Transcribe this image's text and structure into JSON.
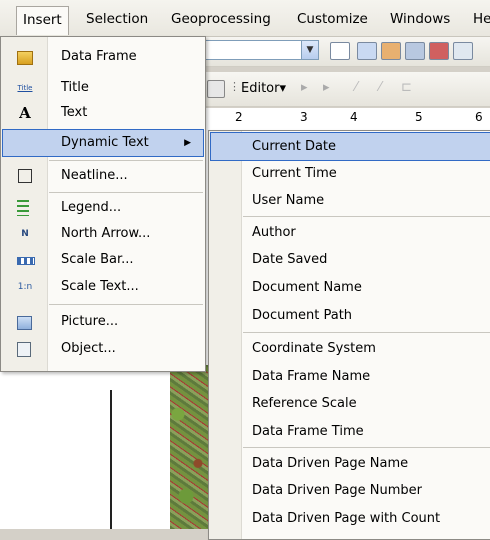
{
  "menubar": {
    "items": [
      "Insert",
      "Selection",
      "Geoprocessing",
      "Customize",
      "Windows",
      "He"
    ]
  },
  "toolbar": {
    "editor_label": "Editor▾"
  },
  "ruler": {
    "ticks": [
      "2",
      "3",
      "4",
      "5",
      "6"
    ]
  },
  "insert_menu": {
    "items": [
      {
        "label": "Data Frame",
        "icon": "data-frame-icon"
      },
      {
        "label": "Title",
        "icon": "title-icon"
      },
      {
        "label": "Text",
        "icon": "text-icon"
      },
      {
        "label": "Dynamic Text",
        "icon": "",
        "submenu": true,
        "highlighted": true
      },
      {
        "label": "Neatline...",
        "icon": "neatline-icon"
      },
      {
        "label": "Legend...",
        "icon": "legend-icon"
      },
      {
        "label": "North Arrow...",
        "icon": "north-arrow-icon"
      },
      {
        "label": "Scale Bar...",
        "icon": "scale-bar-icon"
      },
      {
        "label": "Scale Text...",
        "icon": "scale-text-icon"
      },
      {
        "label": "Picture...",
        "icon": "picture-icon"
      },
      {
        "label": "Object...",
        "icon": "object-icon"
      }
    ],
    "icon_glyphs": {
      "title": "Title",
      "text": "A",
      "north": "N",
      "scaletext": "1:n"
    }
  },
  "dynamic_text_menu": {
    "items": [
      "Current Date",
      "Current Time",
      "User Name",
      "Author",
      "Date Saved",
      "Document Name",
      "Document Path",
      "Coordinate System",
      "Data Frame Name",
      "Reference Scale",
      "Data Frame Time",
      "Data Driven Page Name",
      "Data Driven Page Number",
      "Data Driven Page with Count"
    ],
    "highlighted": "Current Date"
  },
  "colors": {
    "highlight": "#c1d2ee",
    "highlight_border": "#316ac5"
  }
}
